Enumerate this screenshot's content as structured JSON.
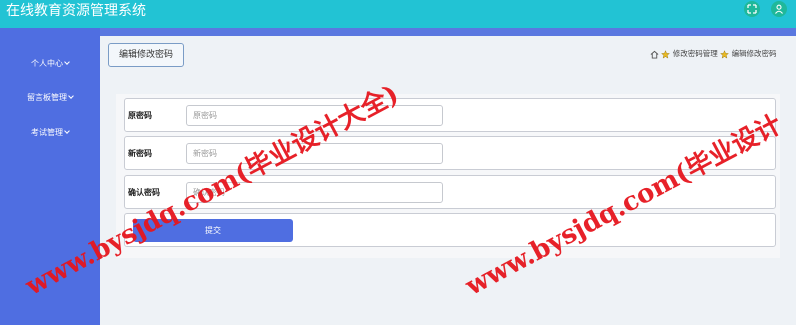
{
  "header": {
    "app_title": "在线教育资源管理系统",
    "icons": [
      "fullscreen-icon",
      "user-icon"
    ]
  },
  "sidebar": {
    "items": [
      {
        "label": "个人中心"
      },
      {
        "label": "留言板管理"
      },
      {
        "label": "考试管理"
      }
    ]
  },
  "tab": {
    "label": "编辑修改密码"
  },
  "breadcrumb": {
    "items": [
      "修改密码管理",
      "编辑修改密码"
    ]
  },
  "form": {
    "old_password": {
      "label": "原密码",
      "placeholder": "原密码"
    },
    "new_password": {
      "label": "新密码",
      "placeholder": "新密码"
    },
    "confirm_password": {
      "label": "确认密码",
      "placeholder": "确认密码"
    },
    "submit_label": "提交"
  },
  "watermark": {
    "text_full": "www.bysjdq.com(毕业设计大全)",
    "text_partial": "www.bysjdq.com(毕业设计"
  },
  "colors": {
    "header": "#22c3d4",
    "sidebar": "#4f6ee1",
    "button": "#4f6ee1",
    "watermark": "#e6161e"
  }
}
